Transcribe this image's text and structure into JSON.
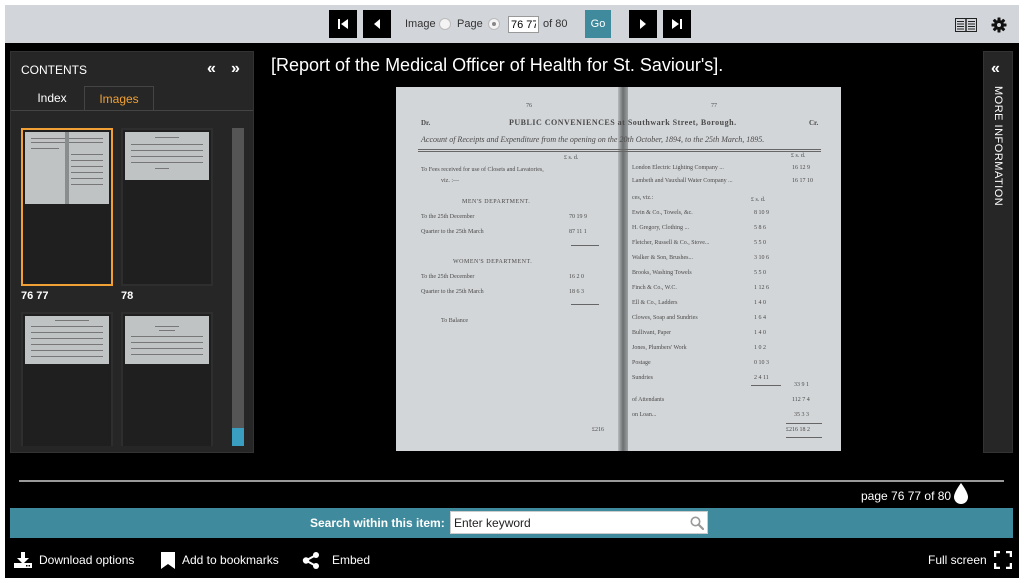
{
  "toolbar": {
    "image_label": "Image",
    "page_label": "Page",
    "page_value": "76 77",
    "of_label": "of 80",
    "go_label": "Go",
    "selected_mode": "page",
    "icons": [
      "first-page-icon",
      "previous-page-icon",
      "next-page-icon",
      "last-page-icon",
      "book-view-icon",
      "gear-icon"
    ]
  },
  "contents": {
    "title": "CONTENTS",
    "collapse_icon": "«",
    "expand_icon": "»",
    "tabs": [
      {
        "label": "Index",
        "active": false
      },
      {
        "label": "Images",
        "active": true
      }
    ],
    "thumbnails": [
      {
        "label": "76 77",
        "selected": true
      },
      {
        "label": "78",
        "selected": false
      },
      {
        "label": "",
        "selected": false
      },
      {
        "label": "",
        "selected": false
      }
    ]
  },
  "document": {
    "title": "[Report of the Medical Officer of Health for St. Saviour's].",
    "scan": {
      "page_left": "76",
      "page_right": "77",
      "dr": "Dr.",
      "cr": "Cr.",
      "heading": "PUBLIC CONVENIENCES at Southwark Street, Borough.",
      "subheading": "Account of Receipts and Expenditure from the opening on the 20th October, 1894, to the 25th March, 1895.",
      "lsd": "£  s.  d.",
      "left_lines": [
        "To Fees received for use of Closets and Lavatories,",
        "viz. :—",
        "MEN'S DEPARTMENT.",
        "To the 25th December",
        "Quarter to the 25th March",
        "WOMEN'S DEPARTMENT.",
        "To the 25th December",
        "Quarter to the 25th March",
        "To Balance"
      ],
      "left_values": [
        "70 19 9",
        "87 11 1",
        "16 2 0",
        "18 6 3"
      ],
      "right_lines": [
        "London Electric Lighting Company ...",
        "Lambeth and Vauxhall Water Company ...",
        "ces, viz.:",
        "Ewin & Co., Towels, &c.",
        "H. Gregory, Clothing ...",
        "Fletcher, Russell & Co., Stove...",
        "Walker & Son, Brushes...",
        "Brooks, Washing Towels",
        "Finch & Co., W.C.",
        "Ell & Co., Ladders",
        "Clowes, Soap and Sundries",
        "Bullivant, Paper",
        "Jones, Plumbers' Work",
        "Postage",
        "Sundries",
        "of Attendants",
        "on Loan..."
      ],
      "right_values": [
        "16 12 9",
        "16 17 10",
        "8 10 9",
        "5 8 6",
        "5 5 0",
        "3 10 6",
        "5 5 0",
        "1 12 6",
        "1 4 0",
        "1 6 4",
        "1 4 0",
        "1 0 2",
        "0 10 3",
        "2 4 11"
      ],
      "right_totals": [
        "33 9 1",
        "112 7 4",
        "35 3 3",
        "£216 18 2"
      ],
      "left_total": "£216"
    }
  },
  "more_info": {
    "label": "MORE INFORMATION",
    "icon": "«"
  },
  "slider": {
    "readout": "page 76 77 of 80",
    "position_fraction": 1.0
  },
  "search": {
    "label": "Search within this item:",
    "placeholder": "Enter keyword",
    "value": ""
  },
  "footer": {
    "download": "Download options",
    "bookmark": "Add to bookmarks",
    "embed": "Embed",
    "fullscreen": "Full screen"
  },
  "colors": {
    "accent_orange": "#f0a035",
    "teal": "#3f8a9c",
    "toolbar_bg": "#d2d5d9",
    "panel_bg": "#262626"
  }
}
